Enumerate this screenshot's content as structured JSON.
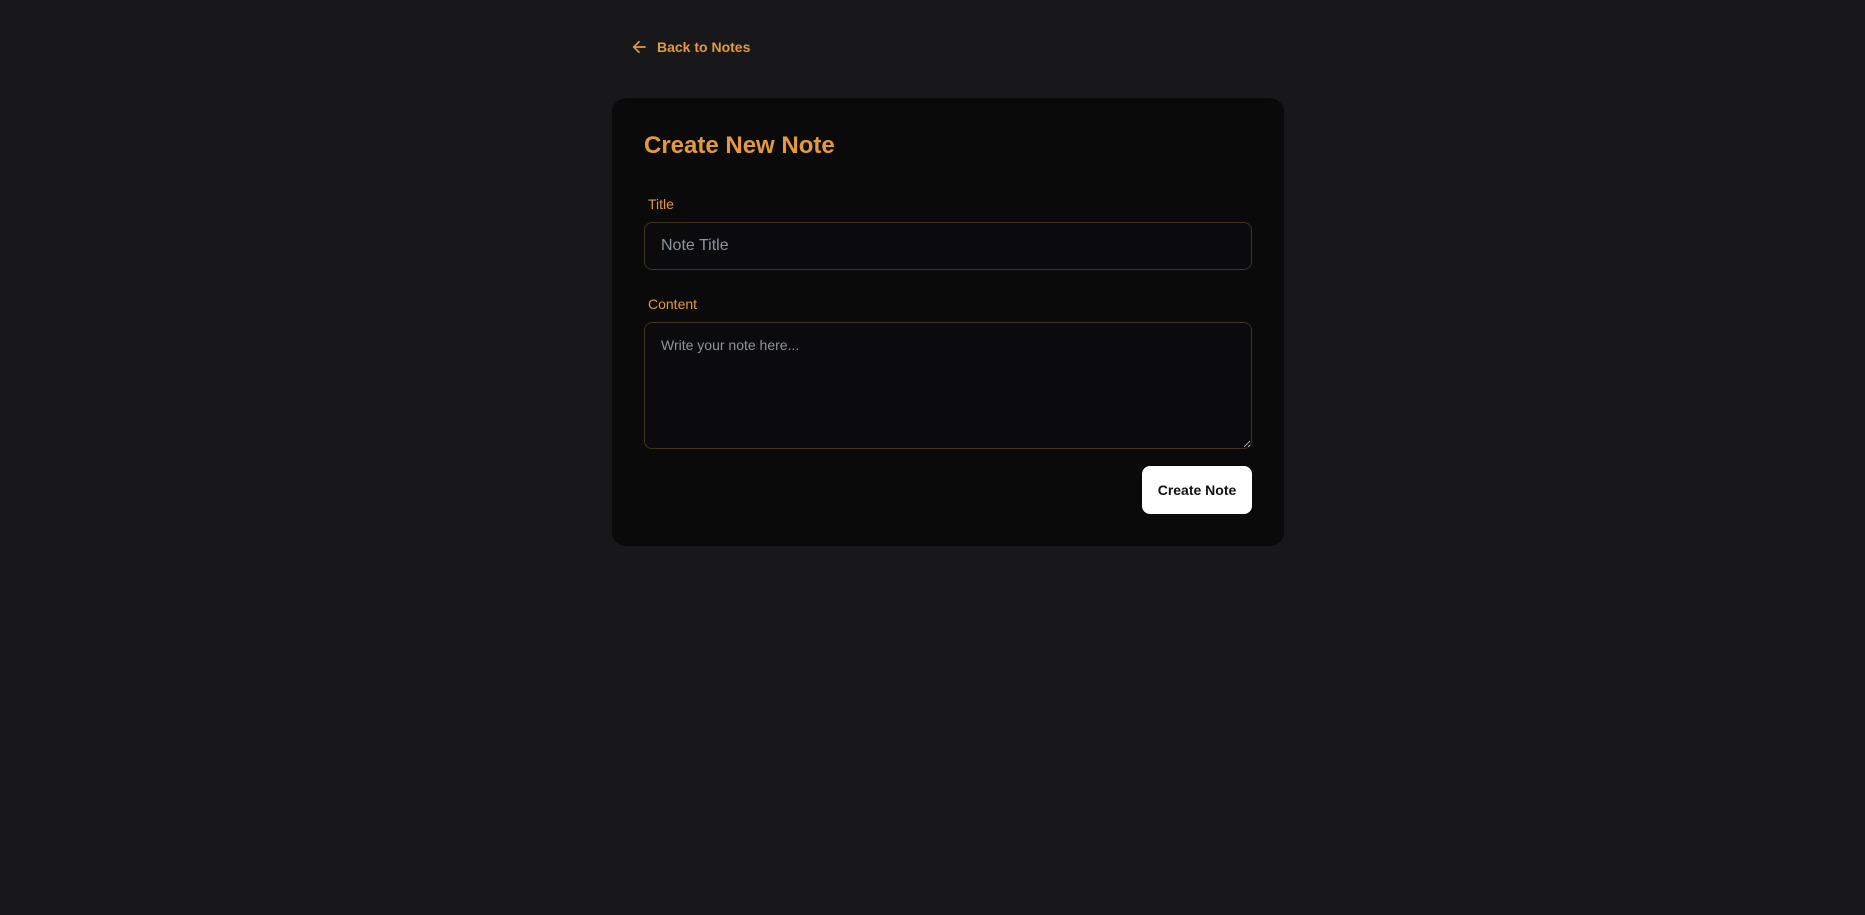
{
  "nav": {
    "back_label": "Back to Notes",
    "back_icon": "arrow-left-icon"
  },
  "form": {
    "heading": "Create New Note",
    "title_label": "Title",
    "title_placeholder": "Note Title",
    "title_value": "",
    "content_label": "Content",
    "content_placeholder": "Write your note here...",
    "content_value": "",
    "submit_label": "Create Note"
  },
  "colors": {
    "background": "#18181b",
    "card": "#0a0a0b",
    "accent": "#e39a3d",
    "button_bg": "#ffffff",
    "button_text": "#111111"
  }
}
